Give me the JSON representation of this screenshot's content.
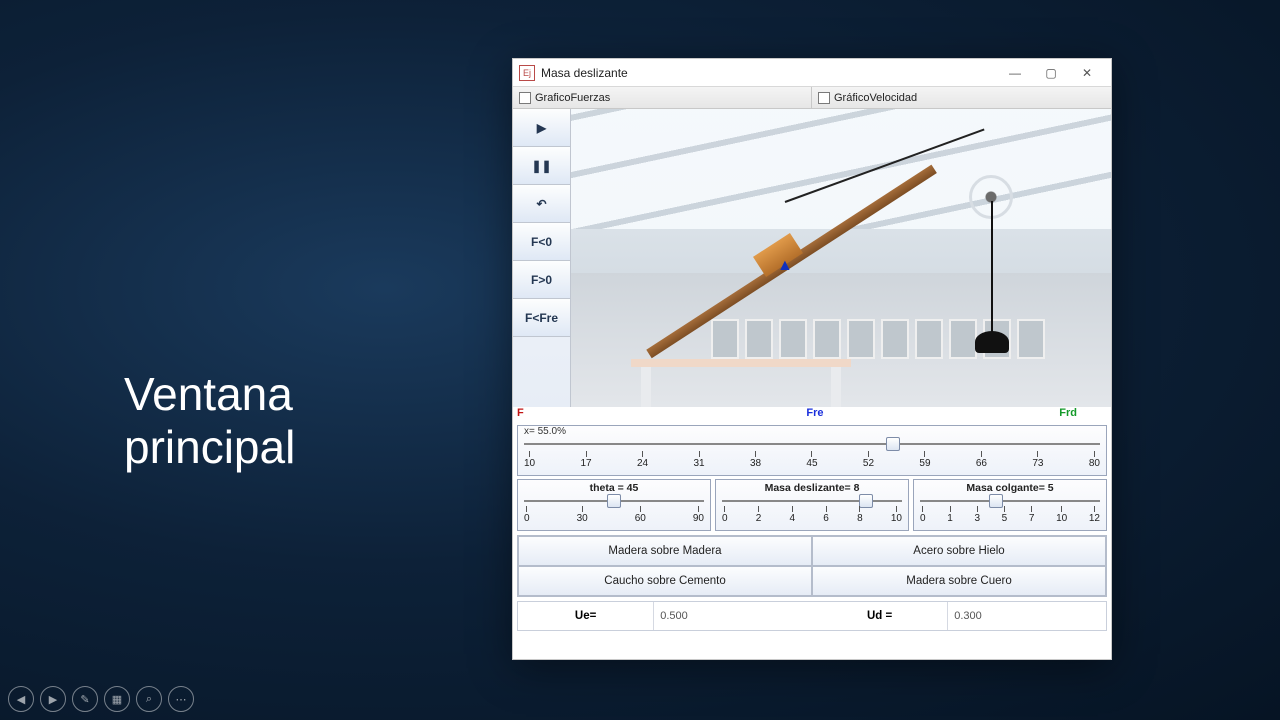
{
  "slide": {
    "title_line1": "Ventana",
    "title_line2": "principal"
  },
  "window": {
    "title": "Masa deslizante",
    "checkboxes": {
      "forces": "GraficoFuerzas",
      "velocity": "GráficoVelocidad"
    }
  },
  "toolbar": {
    "play": "▶",
    "pause": "❚❚",
    "reset": "↶",
    "fneg": "F<0",
    "fpos": "F>0",
    "ffre": "F<Fre"
  },
  "legend": {
    "f": "F",
    "fre": "Fre",
    "frd": "Frd"
  },
  "sliders": {
    "position": {
      "label": "x= 55.0%",
      "thumb_pct": 64,
      "ticks": [
        "10",
        "17",
        "24",
        "31",
        "38",
        "45",
        "52",
        "59",
        "66",
        "73",
        "80"
      ]
    },
    "theta": {
      "label": "theta  = 45",
      "thumb_pct": 50,
      "ticks": [
        "0",
        "30",
        "60",
        "90"
      ]
    },
    "massS": {
      "label": "Masa deslizante= 8",
      "thumb_pct": 80,
      "ticks": [
        "0",
        "2",
        "4",
        "6",
        "8",
        "10"
      ]
    },
    "massH": {
      "label": "Masa colgante= 5",
      "thumb_pct": 42,
      "ticks": [
        "0",
        "1",
        "3",
        "5",
        "7",
        "10",
        "12"
      ]
    }
  },
  "materials": {
    "a": "Madera sobre Madera",
    "b": "Acero sobre Hielo",
    "c": "Caucho sobre Cemento",
    "d": "Madera sobre Cuero"
  },
  "coeffs": {
    "ue_label": "Ue=",
    "ue_value": "0.500",
    "ud_label": "Ud =",
    "ud_value": "0.300"
  }
}
